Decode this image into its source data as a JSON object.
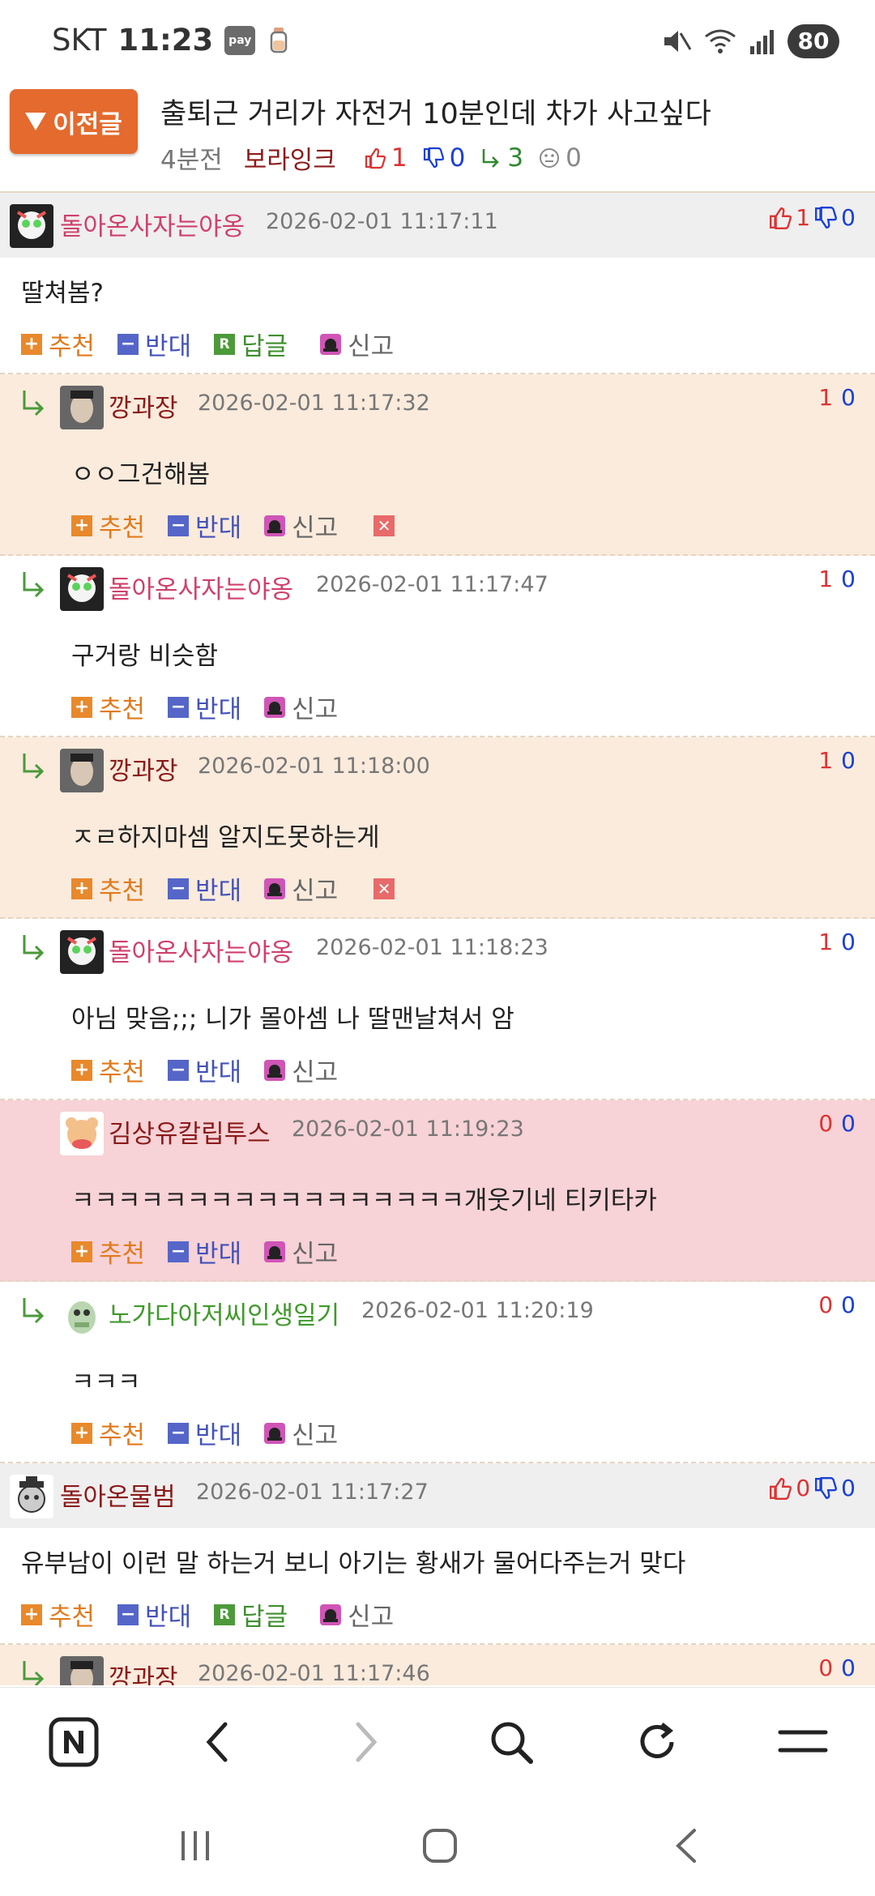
{
  "status_bar": {
    "carrier": "SKT",
    "time": "11:23",
    "pay_badge": "pay",
    "battery": "80",
    "icons": [
      "pay-icon",
      "baby-bottle-icon",
      "mute-icon",
      "wifi-icon",
      "signal-icon",
      "battery-icon"
    ]
  },
  "article": {
    "prev_button": "이전글",
    "title": "출퇴근 거리가 자전거 10분인데 차가 사고싶다",
    "ago": "4분전",
    "author": "보라잉크",
    "likes": "1",
    "dislikes": "0",
    "replies": "3",
    "neutral": "0"
  },
  "labels": {
    "recommend": "추천",
    "oppose": "반대",
    "reply": "답글",
    "report": "신고"
  },
  "comments": [
    {
      "type": "top",
      "nick": "돌아온사자는야옹",
      "date": "2026-02-01 11:17:11",
      "text": "딸쳐봄?",
      "up": "1",
      "down": "0"
    },
    {
      "type": "reply",
      "nick": "깡과장",
      "date": "2026-02-01 11:17:32",
      "text": "ㅇㅇ그건해봄",
      "up": "1",
      "down": "0",
      "deletable": true
    },
    {
      "type": "reply",
      "nick": "돌아온사자는야옹",
      "date": "2026-02-01 11:17:47",
      "text": "구거랑 비슷함",
      "up": "1",
      "down": "0"
    },
    {
      "type": "reply",
      "nick": "깡과장",
      "date": "2026-02-01 11:18:00",
      "text": "ㅈㄹ하지마셈 알지도못하는게",
      "up": "1",
      "down": "0",
      "deletable": true
    },
    {
      "type": "reply",
      "nick": "돌아온사자는야옹",
      "date": "2026-02-01 11:18:23",
      "text": "아님 맞음;;; 니가 몰아셈 나 딸맨날쳐서 암",
      "up": "1",
      "down": "0"
    },
    {
      "type": "reply",
      "nick": "김상유칼립투스",
      "date": "2026-02-01 11:19:23",
      "text": "ㅋㅋㅋㅋㅋㅋㅋㅋㅋㅋㅋㅋㅋㅋㅋㅋㅋ개웃기네 티키타카",
      "up": "0",
      "down": "0"
    },
    {
      "type": "reply",
      "nick": "노가다아저씨인생일기",
      "date": "2026-02-01 11:20:19",
      "text": "ㅋㅋㅋ",
      "up": "0",
      "down": "0"
    },
    {
      "type": "top",
      "nick": "돌아온물범",
      "date": "2026-02-01 11:17:27",
      "text": "유부남이 이런 말 하는거 보니 아기는 황새가 물어다주는거 맞다",
      "up": "0",
      "down": "0"
    },
    {
      "type": "reply",
      "nick": "깡과장",
      "date": "2026-02-01 11:17:46",
      "up": "0",
      "down": "0"
    }
  ],
  "browser_bar": {
    "icons": [
      "naver-icon",
      "back-icon",
      "forward-icon",
      "search-icon",
      "refresh-icon",
      "menu-icon"
    ]
  },
  "nav_bar": {
    "icons": [
      "recents-icon",
      "home-icon",
      "system-back-icon"
    ]
  },
  "colors": {
    "accent_orange": "#e46a2e",
    "tan_row": "#faebdc",
    "pink_row": "#f7d2d6",
    "header_gray": "#efefef"
  }
}
